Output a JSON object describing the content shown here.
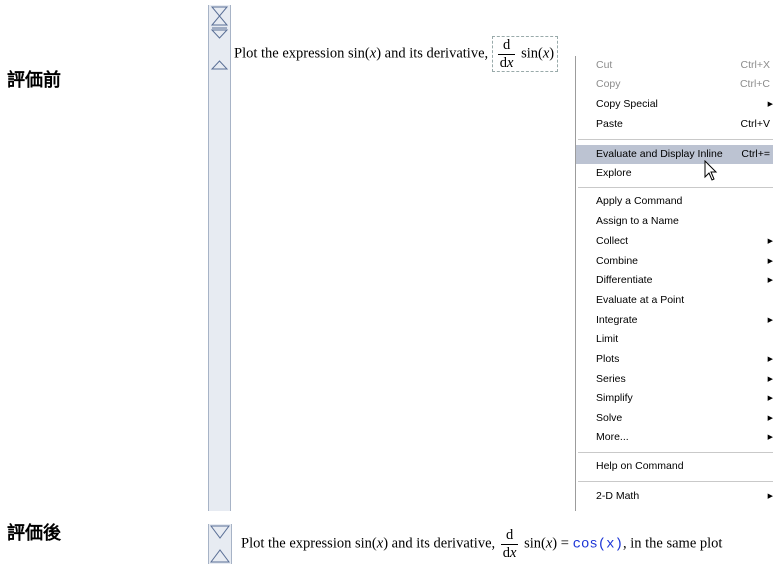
{
  "labels": {
    "before": "評価前",
    "after": "評価後"
  },
  "before": {
    "text": "Plot the expression",
    "sin": "sin",
    "x": "x",
    "and_deriv": "and its derivative,",
    "d": "d",
    "dx": "d",
    "sin2": "sin"
  },
  "after": {
    "text": "Plot the expression",
    "sin": "sin",
    "x": "x",
    "and_deriv": "and its derivative,",
    "d": "d",
    "dx": "d",
    "sin2": "sin",
    "eq": "=",
    "result": "cos(x)",
    "rest": ", in the same plot"
  },
  "menu": {
    "items": [
      {
        "label": "Cut",
        "shortcut": "Ctrl+X",
        "disabled": true
      },
      {
        "label": "Copy",
        "shortcut": "Ctrl+C",
        "disabled": true
      },
      {
        "label": "Copy Special",
        "submenu": true
      },
      {
        "label": "Paste",
        "shortcut": "Ctrl+V"
      },
      {
        "label": "Evaluate and Display Inline",
        "shortcut": "Ctrl+=",
        "active": true
      },
      {
        "label": "Explore"
      },
      {
        "label": "Apply a Command"
      },
      {
        "label": "Assign to a Name"
      },
      {
        "label": "Collect",
        "submenu": true
      },
      {
        "label": "Combine",
        "submenu": true
      },
      {
        "label": "Differentiate",
        "submenu": true
      },
      {
        "label": "Evaluate at a Point"
      },
      {
        "label": "Integrate",
        "submenu": true
      },
      {
        "label": "Limit"
      },
      {
        "label": "Plots",
        "submenu": true
      },
      {
        "label": "Series",
        "submenu": true
      },
      {
        "label": "Simplify",
        "submenu": true
      },
      {
        "label": "Solve",
        "submenu": true
      },
      {
        "label": "More...",
        "submenu": true
      },
      {
        "label": "Help on Command"
      },
      {
        "label": "2-D Math",
        "submenu": true
      }
    ]
  },
  "colors": {
    "result": "#1a33d6",
    "highlight": "#bcc3d2"
  },
  "icons": [
    "triangle-down-icon",
    "triangle-up-icon",
    "double-triangle-icon",
    "submenu-arrow-icon",
    "mouse-cursor-icon"
  ]
}
